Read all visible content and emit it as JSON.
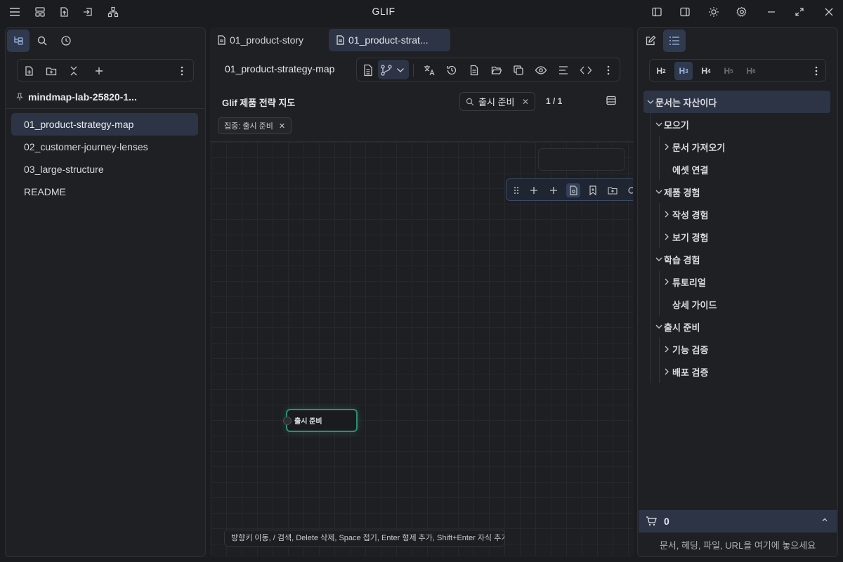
{
  "app": {
    "title": "GLIF"
  },
  "titlebar": {
    "left_icons": [
      "menu-icon",
      "layout-icon",
      "export-icon",
      "import-icon",
      "sitemap-icon"
    ],
    "right_icons": [
      "sidebar-left-icon",
      "sidebar-right-icon",
      "sun-icon",
      "gear-icon",
      "minimize-icon",
      "maximize-icon",
      "close-icon"
    ]
  },
  "left_panel": {
    "tabs": [
      "file-tree-icon",
      "search-icon",
      "clock-icon"
    ],
    "toolbar": [
      "new-file-icon",
      "new-folder-icon",
      "collapse-icon",
      "plus-icon",
      "more-icon"
    ],
    "vault_name": "mindmap-lab-25820-1...",
    "files": [
      {
        "label": "01_product-strategy-map",
        "active": true
      },
      {
        "label": "02_customer-journey-lenses",
        "active": false
      },
      {
        "label": "03_large-structure",
        "active": false
      },
      {
        "label": "README",
        "active": false
      }
    ]
  },
  "center": {
    "tabs": [
      {
        "label": "01_product-story",
        "active": false
      },
      {
        "label": "01_product-strat...",
        "active": true
      }
    ],
    "doc_title": "01_product-strategy-map",
    "map_title": "Glif 제품 전략 지도",
    "search": {
      "value": "출시 준비",
      "match_count": "1 / 1"
    },
    "focus_chip": "집중: 출시 준비",
    "node_label": "출시 준비",
    "hint": "방향키 이동, / 검색, Delete 삭제, Space 접기, Enter 형제 추가, Shift+Enter 자식 추가, Tab"
  },
  "right_panel": {
    "tabs": [
      "edit-icon",
      "list-icon"
    ],
    "headings": [
      {
        "label": "H",
        "level": "2"
      },
      {
        "label": "H",
        "level": "3"
      },
      {
        "label": "H",
        "level": "4"
      },
      {
        "label": "H",
        "level": "5"
      },
      {
        "label": "H",
        "level": "6"
      }
    ],
    "outline": [
      {
        "label": "문서는 자산이다"
      },
      {
        "label": "모으기"
      },
      {
        "label": "문서 가져오기"
      },
      {
        "label": "에셋 연결"
      },
      {
        "label": "제품 경험"
      },
      {
        "label": "작성 경험"
      },
      {
        "label": "보기 경험"
      },
      {
        "label": "학습 경험"
      },
      {
        "label": "튜토리얼"
      },
      {
        "label": "상세 가이드"
      },
      {
        "label": "출시 준비"
      },
      {
        "label": "기능 검증"
      },
      {
        "label": "배포 검증"
      }
    ],
    "cart_count": "0",
    "drop_hint": "문서, 헤딩, 파일, URL을 여기에 놓으세요"
  },
  "colors": {
    "accent": "#2c3445",
    "node_border": "#2e8f72",
    "background": "#1b1c1f"
  }
}
